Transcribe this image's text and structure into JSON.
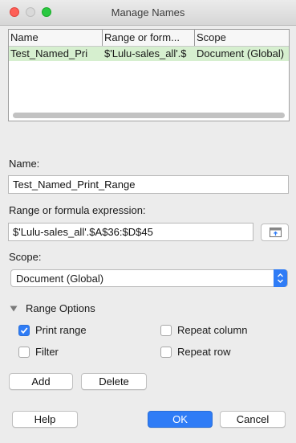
{
  "window": {
    "title": "Manage Names"
  },
  "table": {
    "columns": [
      "Name",
      "Range or form...",
      "Scope"
    ],
    "rows": [
      [
        "Test_Named_Pri",
        "$'Lulu-sales_all'.$",
        "Document (Global)"
      ]
    ]
  },
  "form": {
    "name_label": "Name:",
    "name_value": "Test_Named_Print_Range",
    "range_label": "Range or formula expression:",
    "range_value": "$'Lulu-sales_all'.$A$36:$D$45",
    "scope_label": "Scope:",
    "scope_value": "Document (Global)"
  },
  "range_options": {
    "title": "Range Options",
    "print_range": {
      "label": "Print range",
      "checked": true
    },
    "filter": {
      "label": "Filter",
      "checked": false
    },
    "repeat_column": {
      "label": "Repeat column",
      "checked": false
    },
    "repeat_row": {
      "label": "Repeat row",
      "checked": false
    }
  },
  "buttons": {
    "add": "Add",
    "delete": "Delete",
    "help": "Help",
    "ok": "OK",
    "cancel": "Cancel"
  },
  "colors": {
    "accent": "#2f7cf6",
    "selection_row": "#d6efcf"
  }
}
